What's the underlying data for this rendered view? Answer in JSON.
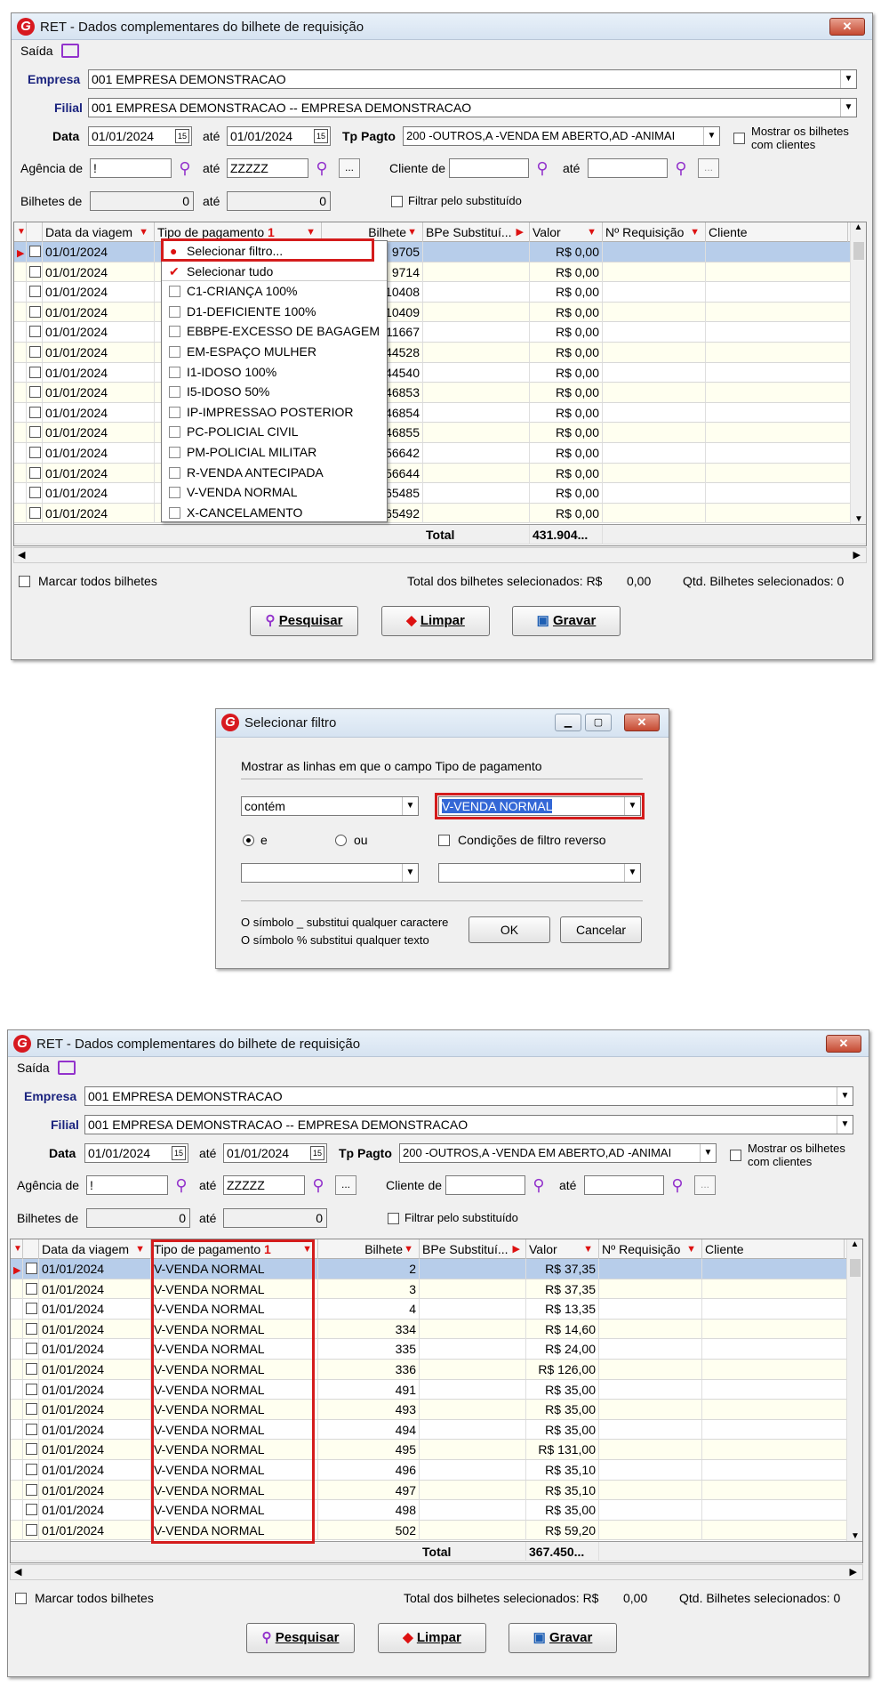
{
  "win1": {
    "title": "RET - Dados complementares do bilhete de requisição",
    "menu": "Saída",
    "empresa_label": "Empresa",
    "empresa_value": "001 EMPRESA DEMONSTRACAO",
    "filial_label": "Filial",
    "filial_value": "001 EMPRESA DEMONSTRACAO -- EMPRESA DEMONSTRACAO",
    "data_label": "Data",
    "data_from": "01/01/2024",
    "ate": "até",
    "data_to": "01/01/2024",
    "tppagto_label": "Tp Pagto",
    "tppagto_value": "200 -OUTROS,A -VENDA EM ABERTO,AD -ANIMAI",
    "mostrar_label": "Mostrar os bilhetes com clientes",
    "agencia_label": "Agência de",
    "agencia_from": "!",
    "agencia_to": "ZZZZZ",
    "dots": "...",
    "cliente_label": "Cliente de",
    "bilhetes_label": "Bilhetes de",
    "bilhetes_from": "0",
    "bilhetes_to": "0",
    "filtrar_label": "Filtrar pelo substituído",
    "columns": [
      "Data da viagem",
      "Tipo de pagamento",
      "Bilhete",
      "BPe Substituí...",
      "Valor",
      "Nº Requisição",
      "Cliente"
    ],
    "sort_badge": "1",
    "rows": [
      {
        "date": "01/01/2024",
        "bilhete": "9705",
        "valor": "R$ 0,00"
      },
      {
        "date": "01/01/2024",
        "bilhete": "9714",
        "valor": "R$ 0,00"
      },
      {
        "date": "01/01/2024",
        "bilhete": "10408",
        "valor": "R$ 0,00"
      },
      {
        "date": "01/01/2024",
        "bilhete": "10409",
        "valor": "R$ 0,00"
      },
      {
        "date": "01/01/2024",
        "bilhete": "11667",
        "valor": "R$ 0,00"
      },
      {
        "date": "01/01/2024",
        "bilhete": "44528",
        "valor": "R$ 0,00"
      },
      {
        "date": "01/01/2024",
        "bilhete": "44540",
        "valor": "R$ 0,00"
      },
      {
        "date": "01/01/2024",
        "bilhete": "46853",
        "valor": "R$ 0,00"
      },
      {
        "date": "01/01/2024",
        "bilhete": "46854",
        "valor": "R$ 0,00"
      },
      {
        "date": "01/01/2024",
        "bilhete": "46855",
        "valor": "R$ 0,00"
      },
      {
        "date": "01/01/2024",
        "bilhete": "56642",
        "valor": "R$ 0,00"
      },
      {
        "date": "01/01/2024",
        "bilhete": "56644",
        "valor": "R$ 0,00"
      },
      {
        "date": "01/01/2024",
        "bilhete": "65485",
        "valor": "R$ 0,00"
      },
      {
        "date": "01/01/2024",
        "bilhete": "65492",
        "valor": "R$ 0,00"
      }
    ],
    "popup_items": [
      "Selecionar filtro...",
      "Selecionar tudo",
      "C1-CRIANÇA 100%",
      "D1-DEFICIENTE 100%",
      "EBBPE-EXCESSO DE BAGAGEM",
      "EM-ESPAÇO MULHER",
      "I1-IDOSO 100%",
      "I5-IDOSO 50%",
      "IP-IMPRESSAO POSTERIOR",
      "PC-POLICIAL CIVIL",
      "PM-POLICIAL MILITAR",
      "R-VENDA ANTECIPADA",
      "V-VENDA NORMAL",
      "X-CANCELAMENTO"
    ],
    "total_label": "Total",
    "total_value": "431.904...",
    "marcar_label": "Marcar todos bilhetes",
    "total_sel_label": "Total dos bilhetes selecionados: R$",
    "total_sel_value": "0,00",
    "qtd_label": "Qtd. Bilhetes selecionados: 0",
    "btn_pesquisar": "Pesquisar",
    "btn_limpar": "Limpar",
    "btn_gravar": "Gravar"
  },
  "dialog": {
    "title": "Selecionar filtro",
    "prompt": "Mostrar as linhas em que o campo Tipo de pagamento",
    "operator": "contém",
    "value": "V-VENDA NORMAL",
    "radio_e": "e",
    "radio_ou": "ou",
    "reverse_label": "Condições de filtro reverso",
    "hint1": "O símbolo _ substitui qualquer caractere",
    "hint2": "O símbolo % substitui qualquer texto",
    "ok": "OK",
    "cancel": "Cancelar"
  },
  "win2": {
    "tipo": "V-VENDA NORMAL",
    "rows": [
      {
        "date": "01/01/2024",
        "bilhete": "2",
        "valor": "R$ 37,35"
      },
      {
        "date": "01/01/2024",
        "bilhete": "3",
        "valor": "R$ 37,35"
      },
      {
        "date": "01/01/2024",
        "bilhete": "4",
        "valor": "R$ 13,35"
      },
      {
        "date": "01/01/2024",
        "bilhete": "334",
        "valor": "R$ 14,60"
      },
      {
        "date": "01/01/2024",
        "bilhete": "335",
        "valor": "R$ 24,00"
      },
      {
        "date": "01/01/2024",
        "bilhete": "336",
        "valor": "R$ 126,00"
      },
      {
        "date": "01/01/2024",
        "bilhete": "491",
        "valor": "R$ 35,00"
      },
      {
        "date": "01/01/2024",
        "bilhete": "493",
        "valor": "R$ 35,00"
      },
      {
        "date": "01/01/2024",
        "bilhete": "494",
        "valor": "R$ 35,00"
      },
      {
        "date": "01/01/2024",
        "bilhete": "495",
        "valor": "R$ 131,00"
      },
      {
        "date": "01/01/2024",
        "bilhete": "496",
        "valor": "R$ 35,10"
      },
      {
        "date": "01/01/2024",
        "bilhete": "497",
        "valor": "R$ 35,10"
      },
      {
        "date": "01/01/2024",
        "bilhete": "498",
        "valor": "R$ 35,00"
      },
      {
        "date": "01/01/2024",
        "bilhete": "502",
        "valor": "R$ 59,20"
      }
    ],
    "total_value": "367.450..."
  }
}
